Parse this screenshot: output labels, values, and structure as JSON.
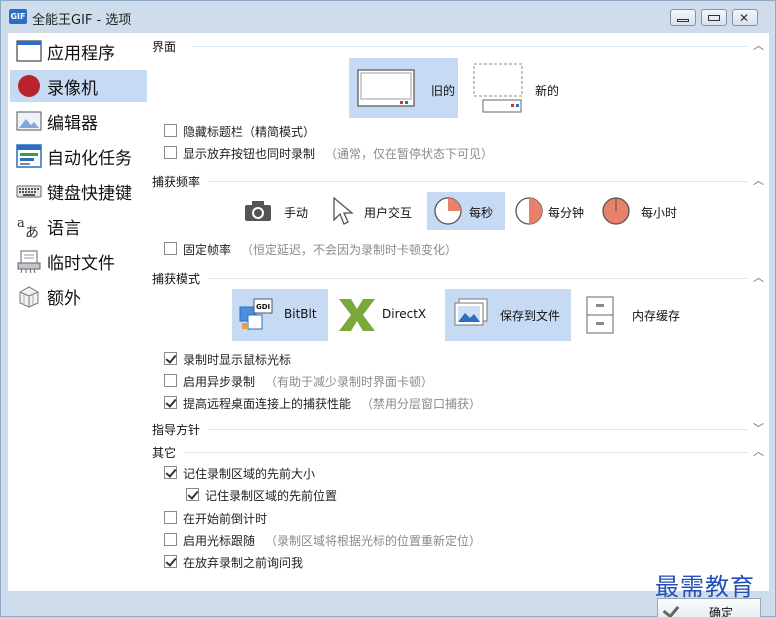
{
  "window": {
    "icon_label": "GIF",
    "title": "全能王GIF - 选项"
  },
  "sidebar": {
    "items": [
      {
        "label": "应用程序",
        "icon": "application-window-icon"
      },
      {
        "label": "录像机",
        "icon": "recorder-icon",
        "active": true
      },
      {
        "label": "编辑器",
        "icon": "editor-image-icon"
      },
      {
        "label": "自动化任务",
        "icon": "automation-list-icon"
      },
      {
        "label": "键盘快捷键",
        "icon": "keyboard-icon"
      },
      {
        "label": "语言",
        "icon": "language-icon"
      },
      {
        "label": "临时文件",
        "icon": "temp-files-icon"
      },
      {
        "label": "额外",
        "icon": "extras-cube-icon"
      }
    ]
  },
  "interface": {
    "title": "界面",
    "style_old": "旧的",
    "style_new": "新的",
    "selected_style": "旧的",
    "options": [
      {
        "label": "隐藏标题栏（精简模式）",
        "hint": "",
        "checked": false
      },
      {
        "label": "显示放弃按钮也同时录制",
        "hint": "（通常，仅在暂停状态下可见）",
        "checked": false
      }
    ]
  },
  "capture_frequency": {
    "title": "捕获频率",
    "modes": [
      {
        "label": "手动",
        "icon": "camera-icon"
      },
      {
        "label": "用户交互",
        "icon": "cursor-arrow-icon"
      },
      {
        "label": "每秒",
        "icon": "clock-quarter-icon"
      },
      {
        "label": "每分钟",
        "icon": "clock-half-icon"
      },
      {
        "label": "每小时",
        "icon": "clock-full-icon"
      }
    ],
    "selected": "每秒",
    "fixed_rate": {
      "label": "固定帧率",
      "hint": "（恒定延迟，不会因为录制时卡顿变化）",
      "checked": false
    }
  },
  "capture_mode": {
    "title": "捕获模式",
    "engines": [
      {
        "label": "BitBlt",
        "icon": "gdi-bitblt-icon"
      },
      {
        "label": "DirectX",
        "icon": "directx-icon"
      }
    ],
    "selected_engine": "BitBlt",
    "storage": [
      {
        "label": "保存到文件",
        "icon": "save-to-file-icon"
      },
      {
        "label": "内存缓存",
        "icon": "memory-cache-icon"
      }
    ],
    "selected_storage": "保存到文件",
    "options": [
      {
        "label": "录制时显示鼠标光标",
        "hint": "",
        "checked": true
      },
      {
        "label": "启用异步录制",
        "hint": "（有助于减少录制时界面卡顿）",
        "checked": false
      },
      {
        "label": "提高远程桌面连接上的捕获性能",
        "hint": "（禁用分层窗口捕获）",
        "checked": true
      }
    ]
  },
  "guidelines": {
    "title": "指导方针"
  },
  "other": {
    "title": "其它",
    "options": [
      {
        "label": "记住录制区域的先前大小",
        "hint": "",
        "checked": true
      },
      {
        "label": "记住录制区域的先前位置",
        "hint": "",
        "checked": true
      },
      {
        "label": "在开始前倒计时",
        "hint": "",
        "checked": false
      },
      {
        "label": "启用光标跟随",
        "hint": "（录制区域将根据光标的位置重新定位）",
        "checked": false
      },
      {
        "label": "在放弃录制之前询问我",
        "hint": "",
        "checked": true
      }
    ]
  },
  "footer": {
    "ok_label": "确定"
  },
  "watermark": "最需教育",
  "colors": {
    "selection": "#c7daf3",
    "accent": "#2a6fc4",
    "recorder_red": "#b8232d",
    "clock_fill": "#e8806a"
  }
}
